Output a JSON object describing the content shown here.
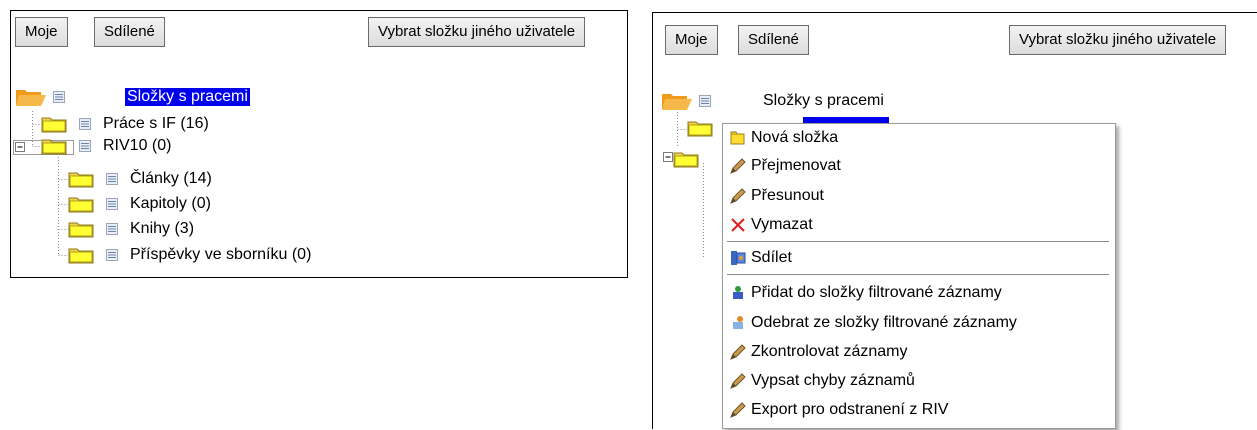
{
  "left": {
    "buttons": {
      "mine": "Moje",
      "shared": "Sdílené",
      "other_user": "Vybrat složku jiného uživatele"
    },
    "tree": {
      "root": "Složky s pracemi",
      "items": [
        "Práce s IF (16)",
        "RIV10 (0)",
        "Články (14)",
        "Kapitoly (0)",
        "Knihy (3)",
        "Příspěvky ve sborníku (0)"
      ]
    }
  },
  "right": {
    "buttons": {
      "mine": "Moje",
      "shared": "Sdílené",
      "other_user": "Vybrat složku jiného uživatele"
    },
    "tree": {
      "root": "Složky s pracemi"
    },
    "context_menu": {
      "items": [
        {
          "label": "Nová složka",
          "icon": "folder-icon"
        },
        {
          "label": "Přejmenovat",
          "icon": "pencil-icon"
        },
        {
          "label": "Přesunout",
          "icon": "pencil-icon"
        },
        {
          "label": "Vymazat",
          "icon": "red-x-icon"
        },
        {
          "label": "Sdílet",
          "icon": "share-icon"
        },
        {
          "label": "Přidat do složky filtrované záznamy",
          "icon": "add-records-icon"
        },
        {
          "label": "Odebrat ze složky filtrované záznamy",
          "icon": "remove-records-icon"
        },
        {
          "label": "Zkontrolovat záznamy",
          "icon": "pencil-icon"
        },
        {
          "label": "Vypsat chyby záznamů",
          "icon": "pencil-icon"
        },
        {
          "label": "Export pro odstranení z RIV",
          "icon": "pencil-icon"
        }
      ]
    }
  },
  "colors": {
    "selection": "#0000ee",
    "folder_open": "#f4a62a",
    "folder": "#ffff33",
    "delete": "#e02020"
  }
}
